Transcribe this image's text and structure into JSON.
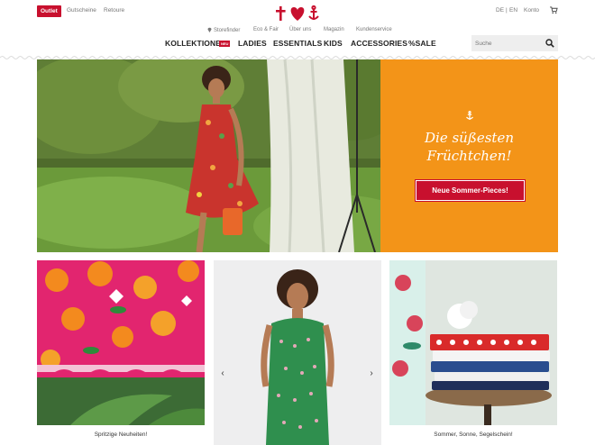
{
  "topbar": {
    "outlet_label": "Outlet",
    "links": [
      "Gutscheine",
      "Retoure"
    ],
    "languages": [
      "DE",
      "EN"
    ],
    "lang_separator": "|",
    "account_label": "Konto"
  },
  "meta_links": [
    "Storefinder",
    "Eco & Fair",
    "Über uns",
    "Magazin",
    "Kundenservice"
  ],
  "nav": {
    "items": [
      "KOLLEKTIONEN",
      "LADIES",
      "ESSENTIALS",
      "KIDS",
      "ACCESSORIES",
      "%SALE"
    ],
    "new_badge": "NEU"
  },
  "search": {
    "placeholder": "Suche"
  },
  "hero": {
    "headline_line1": "Die süßesten",
    "headline_line2": "Früchtchen!",
    "cta_label": "Neue Sommer-Pieces!"
  },
  "tiles": [
    {
      "caption": "Spritzige Neuheiten!"
    },
    {
      "caption": ""
    },
    {
      "caption": "Sommer, Sonne, Segelschein!"
    }
  ],
  "carousel": {
    "prev": "‹",
    "next": "›"
  },
  "colors": {
    "brand_red": "#c8102e",
    "hero_orange": "#f39418"
  }
}
